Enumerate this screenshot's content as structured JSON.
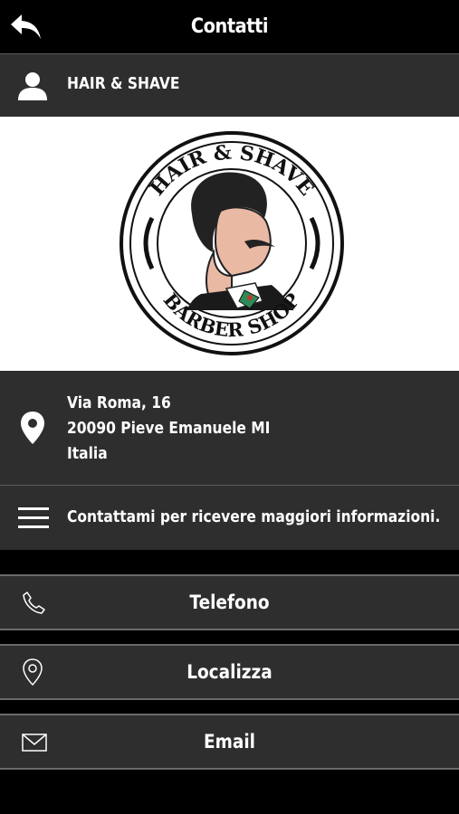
{
  "header": {
    "title": "Contatti",
    "back_icon": "back-arrow-icon"
  },
  "profile": {
    "name": "HAIR & SHAVE",
    "icon": "person-icon"
  },
  "logo": {
    "top_text": "HAIR & SHAVE",
    "bottom_text": "BARBER SHOP"
  },
  "address": {
    "icon": "map-pin-icon",
    "line1": "Via Roma, 16",
    "line2": "20090 Pieve Emanuele MI",
    "line3": "Italia"
  },
  "description": {
    "icon": "menu-lines-icon",
    "text": "Contattami per ricevere maggiori informazioni."
  },
  "actions": [
    {
      "label": "Telefono",
      "icon": "phone-icon"
    },
    {
      "label": "Localizza",
      "icon": "location-icon"
    },
    {
      "label": "Email",
      "icon": "envelope-icon"
    }
  ],
  "colors": {
    "bar": "#000000",
    "row": "#2e2e2e",
    "divider": "#6a6a6a",
    "text": "#ffffff"
  }
}
